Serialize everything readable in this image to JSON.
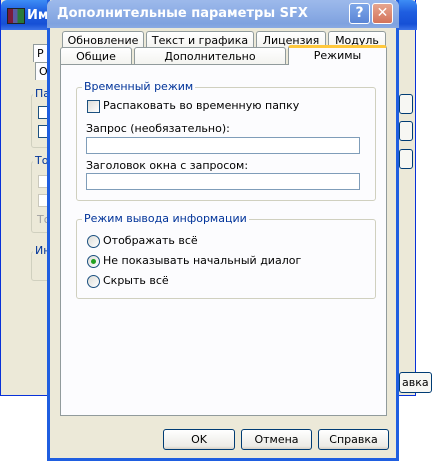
{
  "parent_window": {
    "title": "Имя",
    "tabs": [
      "Р",
      "Об"
    ],
    "groups": [
      "Пар",
      "Том",
      "Ин"
    ],
    "faded_label": "То",
    "button_partial": "авка"
  },
  "dialog": {
    "title": "Дополнительные параметры SFX",
    "help_glyph": "?",
    "close_glyph": "✕",
    "tabs_row1": [
      {
        "label": "Обновление"
      },
      {
        "label": "Текст и графика"
      },
      {
        "label": "Лицензия"
      },
      {
        "label": "Модуль"
      }
    ],
    "tabs_row2": [
      {
        "label": "Общие"
      },
      {
        "label": "Дополнительно"
      },
      {
        "label": "Режимы",
        "active": true
      }
    ],
    "temp_mode": {
      "legend": "Временный режим",
      "unpack_checkbox_label": "Распаковать во временную папку",
      "unpack_checked": false,
      "prompt_label": "Запрос (необязательно):",
      "prompt_value": "",
      "prompt_title_label": "Заголовок окна с запросом:",
      "prompt_title_value": ""
    },
    "output_mode": {
      "legend": "Режим вывода информации",
      "options": [
        {
          "label": "Отображать всё",
          "selected": false
        },
        {
          "label": "Не показывать начальный диалог",
          "selected": true
        },
        {
          "label": "Скрыть всё",
          "selected": false
        }
      ]
    },
    "buttons": {
      "ok": "OK",
      "cancel": "Отмена",
      "help": "Справка"
    }
  }
}
